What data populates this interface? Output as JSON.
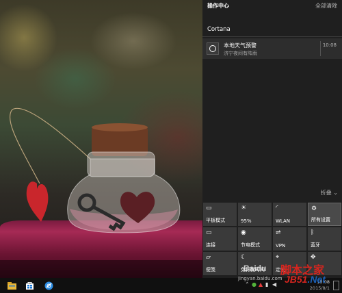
{
  "action_center": {
    "title": "操作中心",
    "clear_all": "全部清除",
    "group": "Cortana",
    "notification": {
      "title": "本地天气预警",
      "body": "济宁夜间有阵雨",
      "time": "10:08",
      "icon": "cortana-ring-icon"
    },
    "collapse": "折叠",
    "tiles": [
      {
        "label": "平板模式",
        "icon": "tablet-mode-icon",
        "glyph": "▭"
      },
      {
        "label": "95%",
        "icon": "brightness-icon",
        "glyph": "☀"
      },
      {
        "label": "WLAN",
        "icon": "wifi-icon",
        "glyph": "◜"
      },
      {
        "label": "所有设置",
        "icon": "gear-icon",
        "glyph": "⚙"
      },
      {
        "label": "连接",
        "icon": "connect-icon",
        "glyph": "▭"
      },
      {
        "label": "节电模式",
        "icon": "battery-saver-icon",
        "glyph": "◉"
      },
      {
        "label": "VPN",
        "icon": "vpn-icon",
        "glyph": "⇌"
      },
      {
        "label": "蓝牙",
        "icon": "bluetooth-icon",
        "glyph": "ᛒ"
      },
      {
        "label": "便笺",
        "icon": "note-icon",
        "glyph": "▱"
      },
      {
        "label": "免打扰时间",
        "icon": "quiet-hours-icon",
        "glyph": "☾"
      },
      {
        "label": "定位",
        "icon": "location-icon",
        "glyph": "⌖"
      },
      {
        "label": "",
        "icon": "project-icon",
        "glyph": "✥"
      }
    ]
  },
  "taskbar": {
    "clock_time": "10:08",
    "clock_date": "2015/8/1",
    "apps": [
      "file-explorer-icon",
      "store-icon",
      "browser-icon"
    ]
  },
  "watermark": {
    "brand": "Baidu",
    "site_cn": "脚本之家",
    "site": "jingyan.baidu.com",
    "logo": "JB51",
    "logo_suffix": ".Net"
  },
  "colors": {
    "panel": "#1f1f1f",
    "tile": "#3a3a3a",
    "taskbar": "#101010",
    "watermark_red": "#d6251f",
    "watermark_blue": "#1a5fb4"
  }
}
